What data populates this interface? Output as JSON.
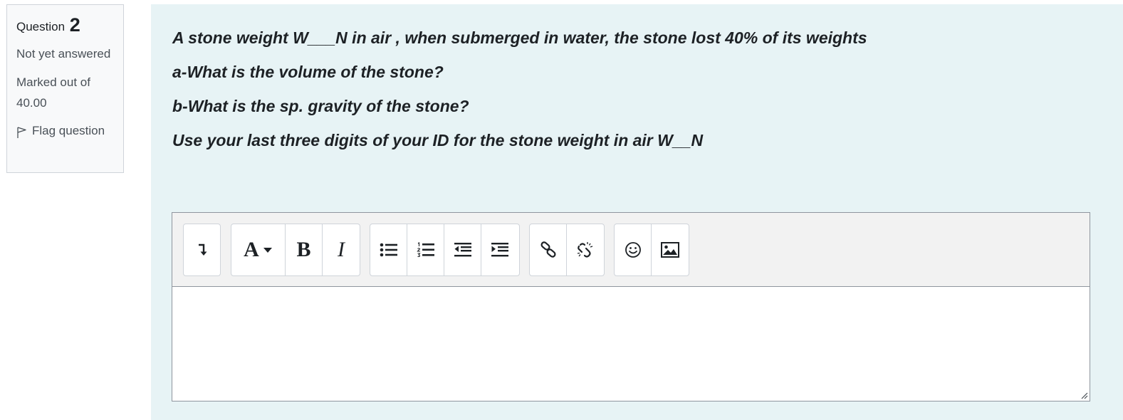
{
  "info": {
    "question_label": "Question",
    "question_number": "2",
    "state": "Not yet answered",
    "grade": "Marked out of 40.00",
    "flag_label": "Flag question",
    "flag_icon": "flag-outline-icon"
  },
  "question": {
    "lines": [
      "A stone weight W___N in air , when submerged in water, the stone lost 40% of its weights",
      "a-What is the volume of the stone?",
      "b-What is the sp. gravity of the stone?",
      "Use your last three digits of your ID for the stone weight in air W__N"
    ]
  },
  "editor": {
    "toolbar": [
      [
        "show-more-icon"
      ],
      [
        "font-style-icon",
        "bold-icon",
        "italic-icon"
      ],
      [
        "unordered-list-icon",
        "ordered-list-icon",
        "outdent-icon",
        "indent-icon"
      ],
      [
        "link-icon",
        "unlink-icon"
      ],
      [
        "emoji-icon",
        "image-icon"
      ]
    ],
    "toolbar_glyphs": {
      "font_style": "A",
      "bold": "B",
      "italic": "I"
    },
    "content": ""
  },
  "colors": {
    "content_bg": "#e7f3f5",
    "info_bg": "#f8f9fa",
    "toolbar_bg": "#f2f2f2",
    "text": "#1d2125",
    "muted": "#495057"
  }
}
